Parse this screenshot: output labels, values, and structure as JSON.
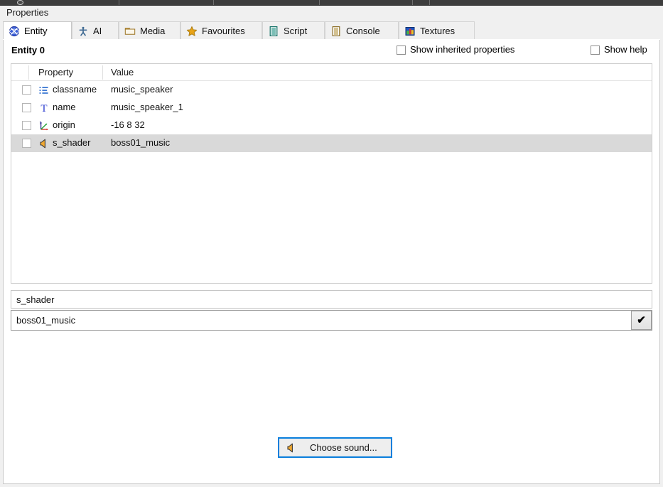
{
  "window": {
    "panel_title": "Properties"
  },
  "tabs": [
    {
      "label": "Entity",
      "icon": "entity-globe-icon",
      "active": true
    },
    {
      "label": "AI",
      "icon": "ai-person-icon",
      "active": false
    },
    {
      "label": "Media",
      "icon": "folder-icon",
      "active": false
    },
    {
      "label": "Favourites",
      "icon": "star-icon",
      "active": false
    },
    {
      "label": "Script",
      "icon": "script-doc-icon",
      "active": false
    },
    {
      "label": "Console",
      "icon": "console-doc-icon",
      "active": false
    },
    {
      "label": "Textures",
      "icon": "textures-icon",
      "active": false
    }
  ],
  "entity": {
    "title": "Entity 0",
    "show_inherited_label": "Show inherited properties",
    "show_inherited_checked": false,
    "show_help_label": "Show help",
    "show_help_checked": false
  },
  "proplist": {
    "columns": [
      "Property",
      "Value"
    ],
    "rows": [
      {
        "icon": "list-icon",
        "name": "classname",
        "value": "music_speaker",
        "checked": false,
        "selected": false
      },
      {
        "icon": "text-t-icon",
        "name": "name",
        "value": "music_speaker_1",
        "checked": false,
        "selected": false
      },
      {
        "icon": "axis-icon",
        "name": "origin",
        "value": "-16 8 32",
        "checked": false,
        "selected": false
      },
      {
        "icon": "speaker-icon",
        "name": "s_shader",
        "value": "boss01_music",
        "checked": false,
        "selected": true
      }
    ]
  },
  "editor": {
    "key_value": "s_shader",
    "value_value": "boss01_music",
    "confirm_glyph": "✔",
    "confirm_name": "apply-button"
  },
  "actions": {
    "choose_sound_label": "Choose sound...",
    "choose_sound_icon": "speaker-icon"
  },
  "colors": {
    "focus_blue": "#0a7fdd",
    "selection_gray": "#d9d9d9",
    "speaker_orange": "#f0a830",
    "tab_active_bg": "#ffffff",
    "panel_bg": "#f0f0f0"
  }
}
